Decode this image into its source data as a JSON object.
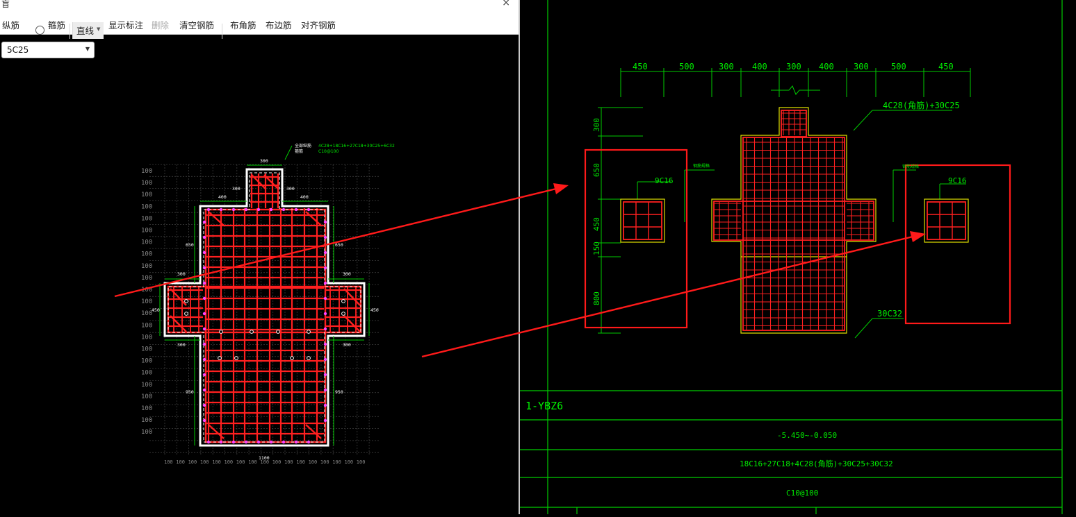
{
  "window": {
    "title_fragment": "盲",
    "close_glyph": "×"
  },
  "toolbar": {
    "longitudinal": "纵筋",
    "stirrup": "箍筋",
    "line_mode": "直线",
    "show_labels": "显示标注",
    "delete": "删除",
    "clear_rebar": "清空钢筋",
    "corner_rebar": "布角筋",
    "edge_rebar": "布边筋",
    "align_rebar": "对齐钢筋"
  },
  "spec_select": {
    "value": "5C25"
  },
  "editor": {
    "callout_line1": "全部纵筋",
    "callout_value1": "4C28+18C16+27C18+30C25+6C32",
    "callout_line2": "箍筋",
    "callout_value2": "C10@100",
    "grid_label": "100",
    "dims": {
      "top": "300",
      "top_left": "300",
      "top_right": "300",
      "mid_left": "400",
      "mid_right": "400",
      "left_upper": "650",
      "right_upper": "650",
      "left_wing": "300",
      "right_wing": "300",
      "left_450": "450",
      "right_450": "450",
      "left_lower": "300",
      "right_lower": "300",
      "lower_left": "950",
      "lower_right": "950",
      "bottom_total": "1100"
    }
  },
  "cad": {
    "top_dims": [
      "450",
      "500",
      "300",
      "400",
      "300",
      "400",
      "300",
      "500",
      "450"
    ],
    "left_dims": [
      "300",
      "650",
      "450",
      "150",
      "800"
    ],
    "label_main_rebar": "4C28(角筋)+30C25",
    "label_9c16_left": "9C16",
    "label_9c16_right": "9C16",
    "label_30c32": "30C32",
    "small_note_left": "钢筋规格",
    "small_note_right": "钢筋规格",
    "table": {
      "id": "1-YBZ6",
      "elevation": "-5.450~-0.050",
      "longitudinal": "18C16+27C18+4C28(角筋)+30C25+30C32",
      "stirrup": "C10@100"
    }
  },
  "colors": {
    "rebar": "#ff2020",
    "cad_green": "#00dd00",
    "outline_yellow": "#e0e000",
    "arrow": "#ff1a1a",
    "white": "#ffffff"
  }
}
